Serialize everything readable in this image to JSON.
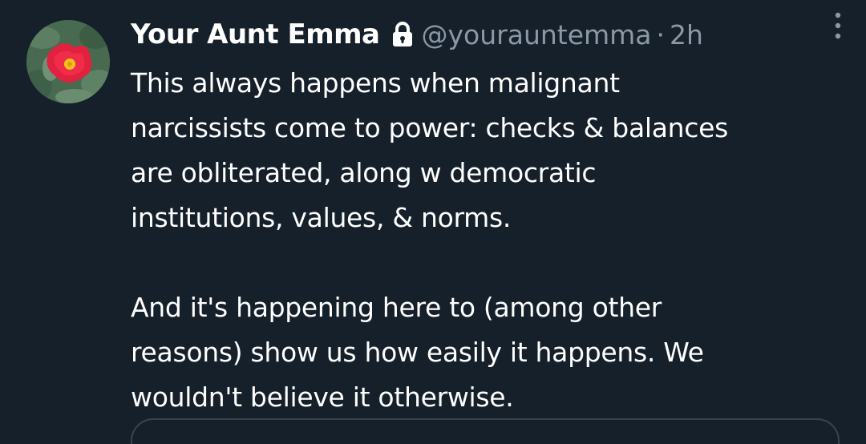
{
  "tweet": {
    "display_name": "Your Aunt Emma",
    "handle": "@yourauntemma",
    "separator": "·",
    "time": "2h",
    "paragraphs": [
      [
        "This always happens when malignant",
        "narcissists come to power: checks & balances",
        "are obliterated, along w democratic",
        "institutions, values, & norms."
      ],
      [
        "And it's happening here to (among other",
        "reasons) show us how easily it happens. We",
        "wouldn't believe it otherwise."
      ]
    ]
  },
  "icons": {
    "avatar": "red-rose-photo",
    "lock": "lock-icon",
    "more": "more-vertical-icon"
  },
  "colors": {
    "background": "#15202b",
    "text": "#ffffff",
    "secondary_text": "#8b98a5",
    "border": "#38444d"
  }
}
